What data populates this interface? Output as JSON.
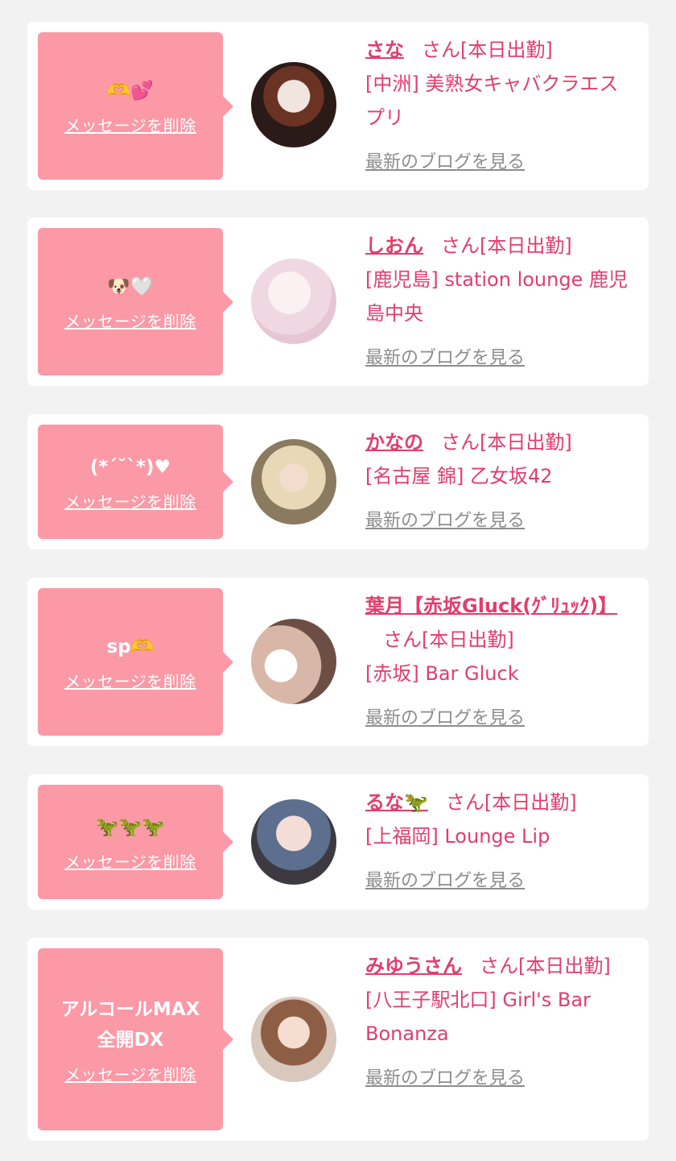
{
  "common": {
    "delete_label": "メッセージを削除",
    "blog_label": "最新のブログを見る",
    "honorific": "さん[本日出勤]"
  },
  "colors": {
    "bubble": "#fb99a6",
    "accent": "#e23d6d",
    "link_gray": "#8d8d8d",
    "background": "#f2f2f2"
  },
  "items": [
    {
      "message": "🫶💕",
      "name": "さな",
      "shop": "[中洲] 美熟女キャバクラエスプリ"
    },
    {
      "message": "🐶🤍",
      "name": "しおん",
      "shop": "[鹿児島] station lounge 鹿児島中央"
    },
    {
      "message": "(*ˊ˘ˋ*)♥",
      "name": "かなの",
      "shop": "[名古屋 錦] 乙女坂42"
    },
    {
      "message": "sp🫶",
      "name": "葉月【赤坂Gluck(ｸﾞﾘｭｯｸ)】",
      "shop": "[赤坂] Bar Gluck"
    },
    {
      "message": "🦖🦖🦖",
      "name": "るな🦖",
      "shop": "[上福岡] Lounge Lip"
    },
    {
      "message": "アルコールMAX\n全開DX",
      "name": "みゆうさん",
      "shop": "[八王子駅北口] Girl's Bar Bonanza"
    }
  ]
}
